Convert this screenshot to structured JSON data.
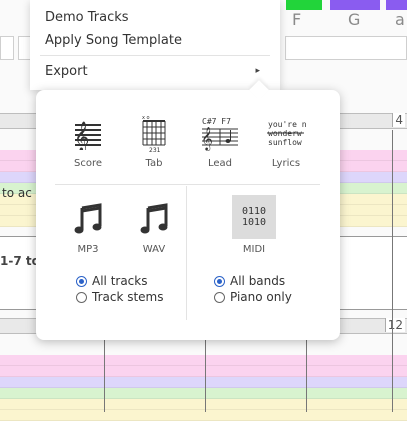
{
  "menu": {
    "items": [
      {
        "label": "Demo Tracks"
      },
      {
        "label": "Apply Song Template"
      },
      {
        "label": "Export"
      }
    ],
    "submenu_arrow": "▸"
  },
  "keys": {
    "labels": [
      "F",
      "G",
      "a"
    ]
  },
  "editor": {
    "measure_numbers": [
      "4",
      "12"
    ],
    "fragment_1": "to ac",
    "fragment_2": "1-7 to"
  },
  "export": {
    "formats_top": [
      {
        "label": "Score",
        "icon": "score-icon"
      },
      {
        "label": "Tab",
        "icon": "tab-icon"
      },
      {
        "label": "Lead",
        "icon": "lead-sheet-icon"
      },
      {
        "label": "Lyrics",
        "icon": "lyrics-icon"
      }
    ],
    "tab_icon_text": {
      "top": "x o",
      "bottom": "231"
    },
    "lead_icon_text": "C#7  F7",
    "lyrics_icon_lines": [
      "you're n",
      "wonderw",
      "sunflow"
    ],
    "audio_formats": [
      {
        "label": "MP3",
        "icon": "music-note-icon"
      },
      {
        "label": "WAV",
        "icon": "music-note-icon"
      }
    ],
    "midi": {
      "label": "MIDI",
      "icon_lines": [
        "0110",
        "1010"
      ]
    },
    "audio_options": [
      {
        "label": "All tracks",
        "selected": true
      },
      {
        "label": "Track stems",
        "selected": false
      }
    ],
    "midi_options": [
      {
        "label": "All bands",
        "selected": true
      },
      {
        "label": "Piano only",
        "selected": false
      }
    ]
  },
  "colors": {
    "accent": "#2b62c8",
    "lane_pink": "#fbd3ef",
    "lane_lavender": "#ddd6fb",
    "lane_green": "#d8f3cf",
    "lane_yellow": "#fbf5cf",
    "key_green": "#22d43a",
    "key_purple": "#8a5cf0"
  }
}
